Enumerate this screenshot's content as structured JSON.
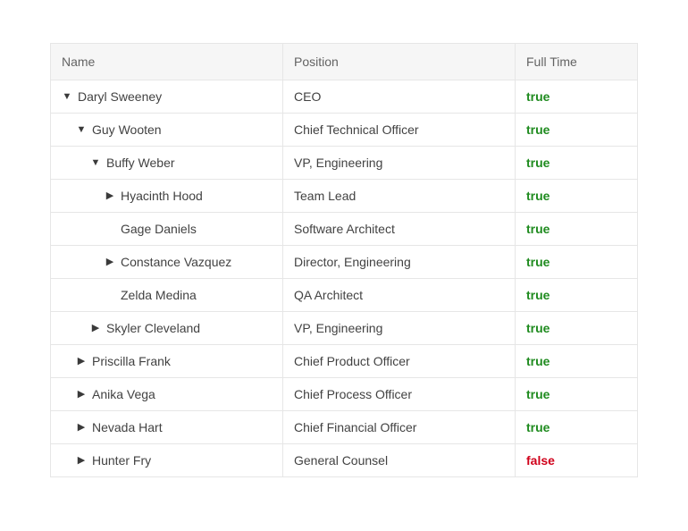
{
  "columns": {
    "name": "Name",
    "position": "Position",
    "fullTime": "Full Time"
  },
  "values": {
    "true": "true",
    "false": "false"
  },
  "rows": [
    {
      "name": "Daryl Sweeney",
      "position": "CEO",
      "fullTime": true,
      "depth": 0,
      "state": "expanded"
    },
    {
      "name": "Guy Wooten",
      "position": "Chief Technical Officer",
      "fullTime": true,
      "depth": 1,
      "state": "expanded"
    },
    {
      "name": "Buffy Weber",
      "position": "VP, Engineering",
      "fullTime": true,
      "depth": 2,
      "state": "expanded"
    },
    {
      "name": "Hyacinth Hood",
      "position": "Team Lead",
      "fullTime": true,
      "depth": 3,
      "state": "collapsed"
    },
    {
      "name": "Gage Daniels",
      "position": "Software Architect",
      "fullTime": true,
      "depth": 3,
      "state": "leaf"
    },
    {
      "name": "Constance Vazquez",
      "position": "Director, Engineering",
      "fullTime": true,
      "depth": 3,
      "state": "collapsed"
    },
    {
      "name": "Zelda Medina",
      "position": "QA Architect",
      "fullTime": true,
      "depth": 3,
      "state": "leaf"
    },
    {
      "name": "Skyler Cleveland",
      "position": "VP, Engineering",
      "fullTime": true,
      "depth": 2,
      "state": "collapsed"
    },
    {
      "name": "Priscilla Frank",
      "position": "Chief Product Officer",
      "fullTime": true,
      "depth": 1,
      "state": "collapsed"
    },
    {
      "name": "Anika Vega",
      "position": "Chief Process Officer",
      "fullTime": true,
      "depth": 1,
      "state": "collapsed"
    },
    {
      "name": "Nevada Hart",
      "position": "Chief Financial Officer",
      "fullTime": true,
      "depth": 1,
      "state": "collapsed"
    },
    {
      "name": "Hunter Fry",
      "position": "General Counsel",
      "fullTime": false,
      "depth": 1,
      "state": "collapsed"
    }
  ]
}
